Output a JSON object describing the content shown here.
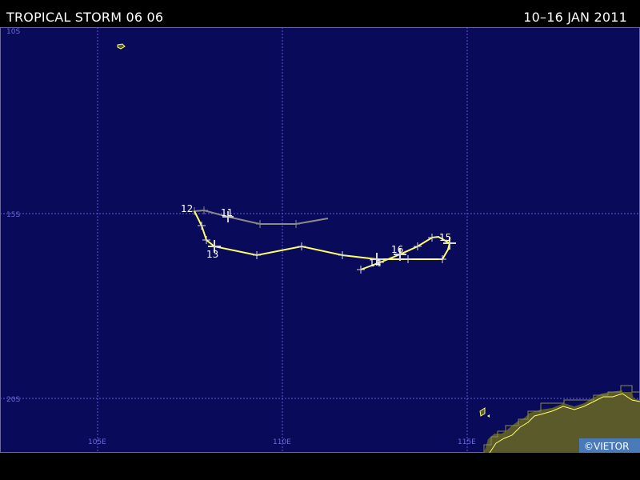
{
  "header": {
    "title": "TROPICAL STORM 06 06",
    "date_range": "10–16 JAN 2011"
  },
  "map": {
    "background_color": "#0a0a5a",
    "grid_color": "#5a5ad8",
    "land_color": "#5a5a2a",
    "coast_color": "#ffff66",
    "lat_labels": [
      "10S",
      "15S",
      "20S"
    ],
    "lon_labels": [
      "105E",
      "110E",
      "115E"
    ]
  },
  "track": {
    "storm_color": "#ffff66",
    "weak_color": "#8a8a8a",
    "day_labels": [
      "11",
      "12",
      "13",
      "14",
      "15",
      "16"
    ]
  },
  "credit": "©VIETOR"
}
